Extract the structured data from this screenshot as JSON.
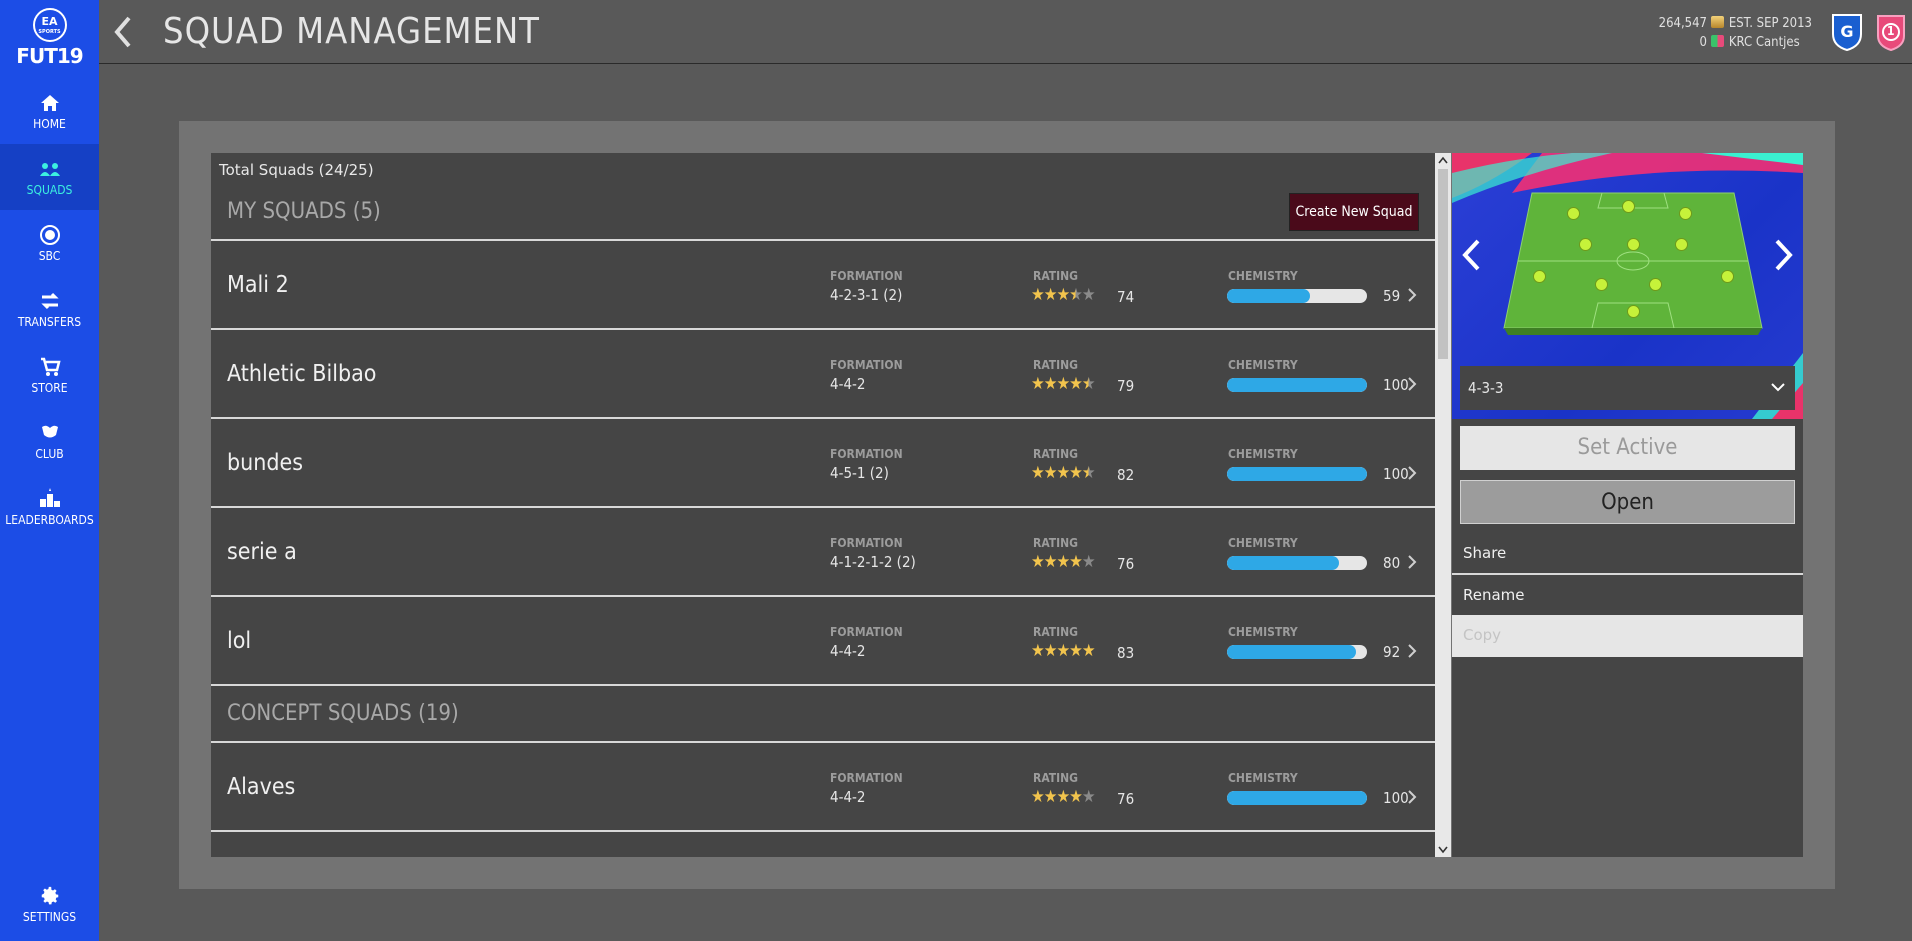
{
  "sidebar": {
    "logo_top": "EA",
    "logo_sub": "SPORTS",
    "logo_text": "FUT19",
    "items": [
      {
        "label": "HOME",
        "icon": "home-icon"
      },
      {
        "label": "SQUADS",
        "icon": "squads-icon",
        "active": true
      },
      {
        "label": "SBC",
        "icon": "sbc-icon"
      },
      {
        "label": "TRANSFERS",
        "icon": "transfers-icon"
      },
      {
        "label": "STORE",
        "icon": "store-icon"
      },
      {
        "label": "CLUB",
        "icon": "club-icon"
      },
      {
        "label": "LEADERBOARDS",
        "icon": "leaderboards-icon"
      }
    ],
    "settings_label": "SETTINGS"
  },
  "header": {
    "title": "SQUAD MANAGEMENT",
    "coins": "264,547",
    "points": "0",
    "established": "EST. SEP 2013",
    "club_name": "KRC Cantjes",
    "division": "1"
  },
  "list": {
    "total": "Total Squads (24/25)",
    "my_squads_title": "MY SQUADS (5)",
    "create_label": "Create New Squad",
    "concept_title": "CONCEPT SQUADS (19)",
    "col_formation": "FORMATION",
    "col_rating": "RATING",
    "col_chemistry": "CHEMISTRY",
    "squads": [
      {
        "name": "Mali 2",
        "formation": "4-2-3-1 (2)",
        "stars": 3.5,
        "rating": "74",
        "chemistry": "59"
      },
      {
        "name": "Athletic Bilbao",
        "formation": "4-4-2",
        "stars": 4.5,
        "rating": "79",
        "chemistry": "100"
      },
      {
        "name": "bundes",
        "formation": "4-5-1 (2)",
        "stars": 4.5,
        "rating": "82",
        "chemistry": "100"
      },
      {
        "name": "serie a",
        "formation": "4-1-2-1-2 (2)",
        "stars": 4,
        "rating": "76",
        "chemistry": "80"
      },
      {
        "name": "lol",
        "formation": "4-4-2",
        "stars": 5,
        "rating": "83",
        "chemistry": "92"
      }
    ],
    "concept_squads": [
      {
        "name": "Alaves",
        "formation": "4-4-2",
        "stars": 4,
        "rating": "76",
        "chemistry": "100"
      }
    ]
  },
  "side": {
    "formation": "4-3-3",
    "set_active_label": "Set Active",
    "open_label": "Open",
    "share_label": "Share",
    "rename_label": "Rename",
    "copy_label": "Copy"
  },
  "colors": {
    "sidebar": "#1c4de6",
    "active_nav_text": "#3cf0e0",
    "chem_fill": "#2ea8e6",
    "star": "#f2c44d",
    "create_button": "#4a0a1a"
  }
}
